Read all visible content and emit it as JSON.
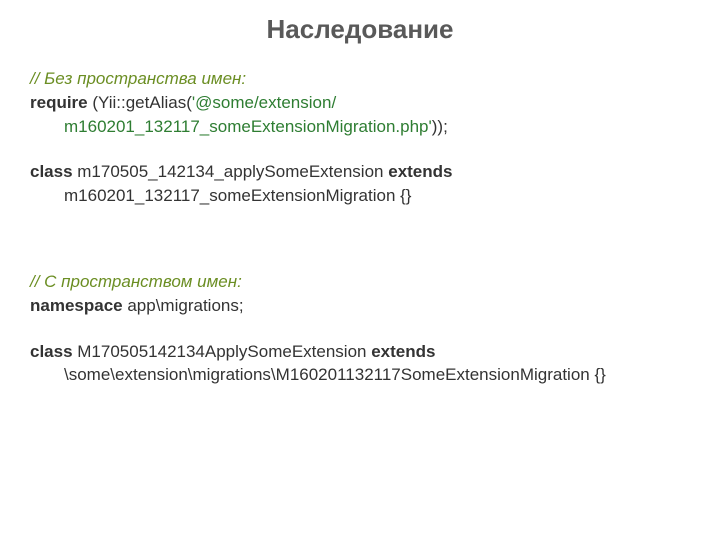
{
  "title": "Наследование",
  "section1": {
    "comment": "// Без пространства имен:",
    "require_kw": "require ",
    "require_open": "(Yii::getAlias(",
    "str_open": "'",
    "path_line1": "@some/extension/",
    "path_line2": "m160201_132117_someExtensionMigration.php",
    "str_close": "'",
    "require_close": "));",
    "class_kw": "class ",
    "class_name": "m170505_142134_applySomeExtension ",
    "extends_kw": "extends",
    "parent": "m160201_132117_someExtensionMigration {}"
  },
  "section2": {
    "comment": "// С пространством имен:",
    "ns_kw": "namespace ",
    "ns_name": "app\\migrations;",
    "class_kw": "class ",
    "class_name": "M170505142134ApplySomeExtension ",
    "extends_kw": "extends",
    "parent": "\\some\\extension\\migrations\\M160201132117SomeExtensionMigration {}"
  }
}
